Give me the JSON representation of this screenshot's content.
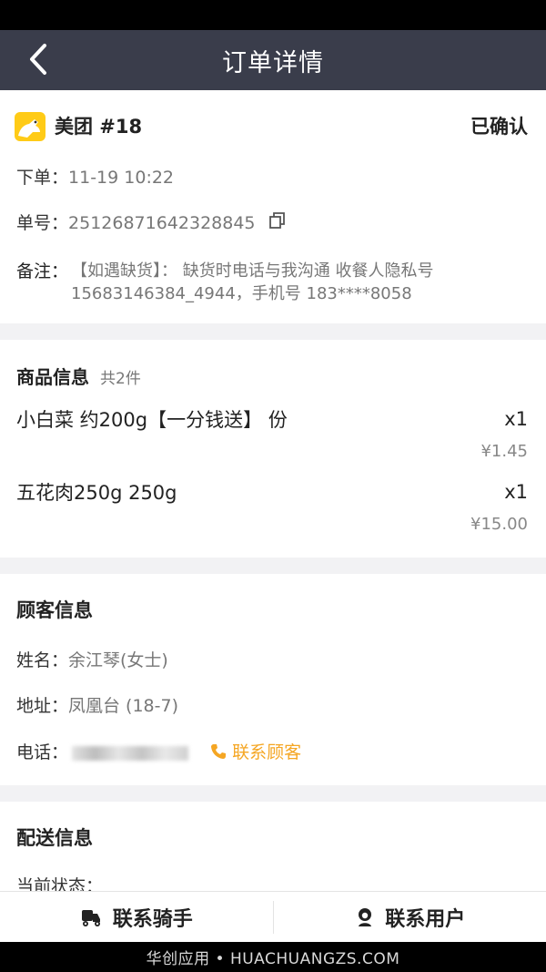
{
  "nav": {
    "title": "订单详情"
  },
  "order": {
    "platform": "美团 #18",
    "status": "已确认",
    "placed_label": "下单：",
    "placed_value": "11-19 10:22",
    "number_label": "单号：",
    "number_value": "25126871642328845",
    "note_label": "备注：",
    "note_line1": "【如遇缺货】： 缺货时电话与我沟通 收餐人隐私号",
    "note_line2": "15683146384_4944，手机号 183****8058"
  },
  "goods": {
    "title": "商品信息",
    "count": "共2件",
    "items": [
      {
        "name": "小白菜 约200g【一分钱送】 份",
        "qty": "x1",
        "price": "¥1.45"
      },
      {
        "name": "五花肉250g 250g",
        "qty": "x1",
        "price": "¥15.00"
      }
    ]
  },
  "customer": {
    "title": "顾客信息",
    "name_label": "姓名：",
    "name_value": "余江琴(女士)",
    "address_label": "地址：",
    "address_value": "凤凰台 (18-7)",
    "phone_label": "电话：",
    "contact_label": "联系顾客"
  },
  "delivery": {
    "title": "配送信息",
    "state_label": "当前状态："
  },
  "bottom": {
    "rider_label": "联系骑手",
    "user_label": "联系用户"
  },
  "watermark": "华创应用 • HUACHUANGZS.COM",
  "colors": {
    "nav_bg": "#3a3d4b",
    "accent": "#f5a623",
    "logo_yellow": "#ffcb17"
  }
}
